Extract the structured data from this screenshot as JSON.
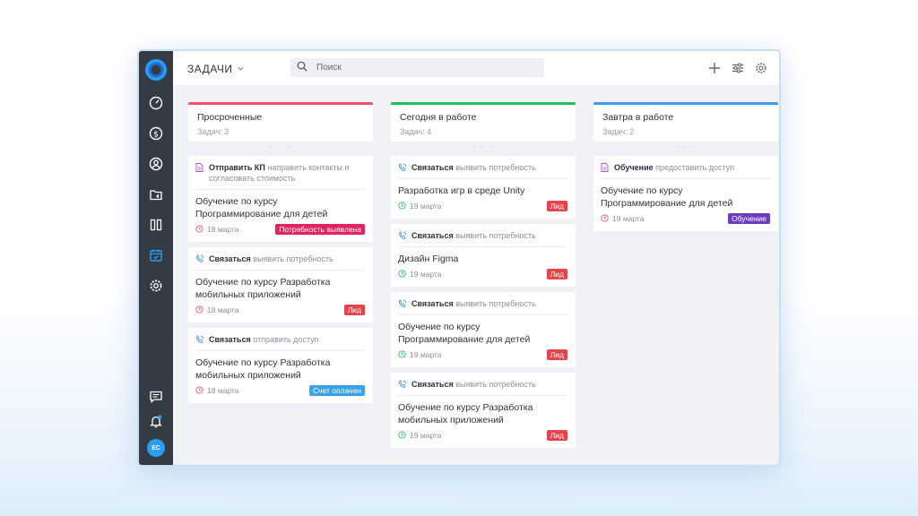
{
  "app": {
    "title": "ЗАДАЧИ",
    "search_placeholder": "Поиск",
    "user_initials": "ЕС"
  },
  "icons": {
    "nav": [
      "dashboard-icon",
      "dollar-icon",
      "contact-icon",
      "folder-share-icon",
      "kanban-icon",
      "calendar-check-icon",
      "settings-icon"
    ],
    "bottom": [
      "chat-icon",
      "bell-icon"
    ],
    "top": [
      "plus-icon",
      "filter-icon",
      "gear-icon"
    ]
  },
  "colors": {
    "overdue": "#f0506e",
    "today": "#22c05a",
    "tomorrow": "#3d9ae8",
    "badge_red": "#e8424a",
    "badge_pink": "#e5215f",
    "badge_blue": "#3ba2e8",
    "badge_purple": "#6d3cc0",
    "sidebar": "#343b45",
    "active_nav": "#2a9df4"
  },
  "columns": [
    {
      "title": "Просроченные",
      "count": "Задач: 3",
      "dots": "· · ·",
      "cards": [
        {
          "icon": "document-icon",
          "action": "Отправить КП",
          "desc": "направить контакты  и согласовать стоимость",
          "title": "Обучение по курсу Программирование для детей",
          "date": "18 марта",
          "date_state": "overdue",
          "badge": "Потребность выявлена",
          "badge_color": "pink"
        },
        {
          "icon": "phone-icon",
          "action": "Связаться",
          "desc": "выявить потребность",
          "title": "Обучение по курсу Разработка мобильных приложений",
          "date": "18 марта",
          "date_state": "overdue",
          "badge": "Лид",
          "badge_color": "red"
        },
        {
          "icon": "phone-icon",
          "action": "Связаться",
          "desc": "отправить доступ",
          "title": "Обучение по курсу Разработка мобильных приложений",
          "date": "18 марта",
          "date_state": "overdue",
          "badge": "Счет оплачен",
          "badge_color": "blue"
        }
      ]
    },
    {
      "title": "Сегодня в работе",
      "count": "Задач: 4",
      "dots": "· · ·",
      "cards": [
        {
          "icon": "phone-icon",
          "action": "Связаться",
          "desc": "выявить потребность",
          "title": "Разработка игр в среде Unity",
          "date": "19 марта",
          "date_state": "today",
          "badge": "Лид",
          "badge_color": "red"
        },
        {
          "icon": "phone-icon",
          "action": "Связаться",
          "desc": "выявить потребность",
          "title": "Дизайн Figma",
          "date": "19 марта",
          "date_state": "today",
          "badge": "Лид",
          "badge_color": "red"
        },
        {
          "icon": "phone-icon",
          "action": "Связаться",
          "desc": "выявить потребность",
          "title": "Обучение по курсу Программирование для детей",
          "date": "19 марта",
          "date_state": "today",
          "badge": "Лид",
          "badge_color": "red"
        },
        {
          "icon": "phone-icon",
          "action": "Связаться",
          "desc": "выявить потребность",
          "title": "Обучение по курсу Разработка мобильных приложений",
          "date": "19 марта",
          "date_state": "today",
          "badge": "Лид",
          "badge_color": "red"
        }
      ]
    },
    {
      "title": "Завтра в работе",
      "count": "Задач: 2",
      "dots": "· · ·",
      "cards": [
        {
          "icon": "document-icon",
          "action": "Обучение",
          "desc": "предоставить доступ",
          "title": "Обучение по курсу Программирование для детей",
          "date": "19 марта",
          "date_state": "overdue",
          "badge": "Обучение",
          "badge_color": "purple"
        }
      ]
    }
  ]
}
